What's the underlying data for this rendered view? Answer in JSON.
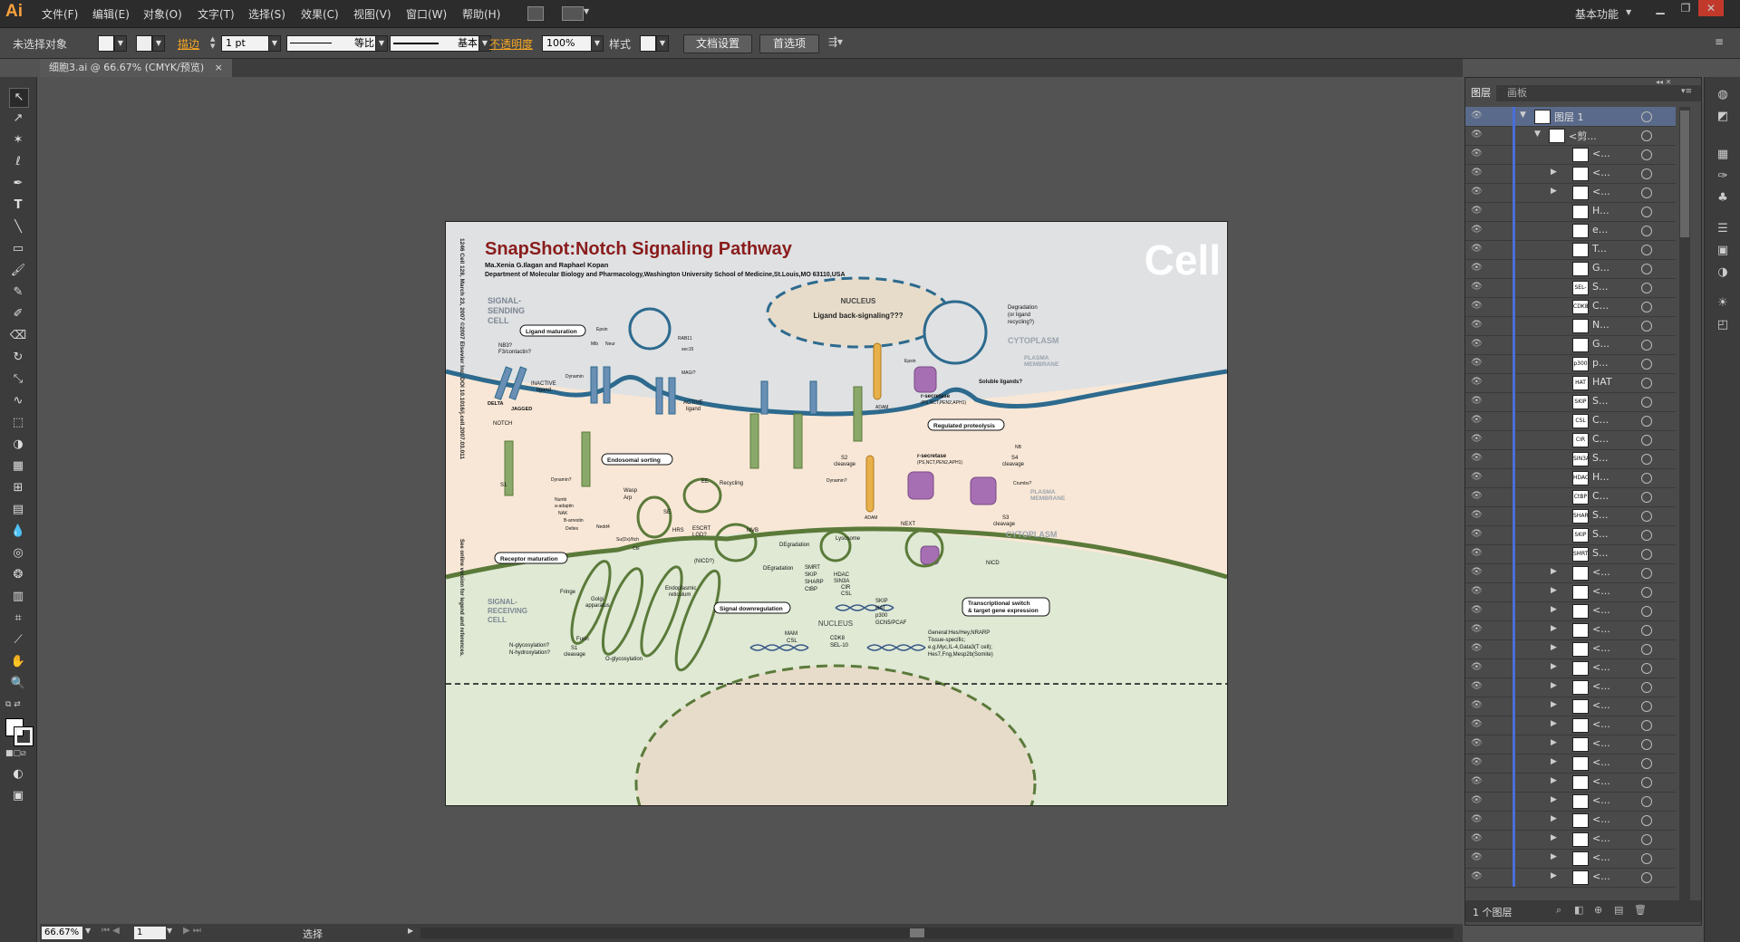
{
  "app": {
    "logo": "Ai"
  },
  "menu": [
    "文件(F)",
    "编辑(E)",
    "对象(O)",
    "文字(T)",
    "选择(S)",
    "效果(C)",
    "视图(V)",
    "窗口(W)",
    "帮助(H)"
  ],
  "workspace": "基本功能",
  "control": {
    "selection": "未选择对象",
    "stroke_label": "描边",
    "stroke_value": "1 pt",
    "stroke_profile": "等比",
    "brush": "基本",
    "opacity_label": "不透明度",
    "opacity_value": "100%",
    "style_label": "样式",
    "doc_setup": "文档设置",
    "prefs": "首选项"
  },
  "document_tab": {
    "title": "细胞3.ai @ 66.67% (CMYK/预览)",
    "close": "×"
  },
  "layers_panel": {
    "tabs": [
      "图层",
      "画板"
    ],
    "rows": [
      {
        "name": "图层 1",
        "thumb": "",
        "expanded": true,
        "indent": 0
      },
      {
        "name": "<剪...",
        "thumb": "",
        "expanded": true,
        "indent": 1
      },
      {
        "name": "<...",
        "thumb": "",
        "indent": 2
      },
      {
        "name": "<...",
        "thumb": "",
        "collapsed": true,
        "indent": 2
      },
      {
        "name": "<...",
        "thumb": "",
        "collapsed": true,
        "indent": 2
      },
      {
        "name": "H...",
        "thumb": "",
        "indent": 2
      },
      {
        "name": "e...",
        "thumb": "",
        "indent": 2
      },
      {
        "name": "T...",
        "thumb": "",
        "indent": 2
      },
      {
        "name": "G...",
        "thumb": "",
        "indent": 2
      },
      {
        "name": "S...",
        "thumb": "SEL-10",
        "indent": 2
      },
      {
        "name": "C...",
        "thumb": "CDK8",
        "indent": 2
      },
      {
        "name": "N...",
        "thumb": "",
        "indent": 2
      },
      {
        "name": "G...",
        "thumb": "",
        "indent": 2
      },
      {
        "name": "p...",
        "thumb": "p300",
        "indent": 2
      },
      {
        "name": "HAT",
        "thumb": "HAT",
        "indent": 2
      },
      {
        "name": "S...",
        "thumb": "SKIP",
        "indent": 2
      },
      {
        "name": "C...",
        "thumb": "CSL",
        "indent": 2
      },
      {
        "name": "C...",
        "thumb": "CIR",
        "indent": 2
      },
      {
        "name": "S...",
        "thumb": "SIN3A",
        "indent": 2
      },
      {
        "name": "H...",
        "thumb": "HDAC",
        "indent": 2
      },
      {
        "name": "C...",
        "thumb": "CtBP",
        "indent": 2
      },
      {
        "name": "S...",
        "thumb": "SHARP",
        "indent": 2
      },
      {
        "name": "S...",
        "thumb": "SKIP",
        "indent": 2
      },
      {
        "name": "S...",
        "thumb": "SMRT",
        "indent": 2
      },
      {
        "name": "<...",
        "thumb": "",
        "collapsed": true,
        "indent": 2
      },
      {
        "name": "<...",
        "thumb": "",
        "collapsed": true,
        "indent": 2
      },
      {
        "name": "<...",
        "thumb": "",
        "collapsed": true,
        "indent": 2
      },
      {
        "name": "<...",
        "thumb": "",
        "collapsed": true,
        "indent": 2
      },
      {
        "name": "<...",
        "thumb": "",
        "collapsed": true,
        "indent": 2
      },
      {
        "name": "<...",
        "thumb": "",
        "collapsed": true,
        "indent": 2
      },
      {
        "name": "<...",
        "thumb": "",
        "collapsed": true,
        "indent": 2
      },
      {
        "name": "<...",
        "thumb": "",
        "collapsed": true,
        "indent": 2
      },
      {
        "name": "<...",
        "thumb": "",
        "collapsed": true,
        "indent": 2
      },
      {
        "name": "<...",
        "thumb": "",
        "collapsed": true,
        "indent": 2
      },
      {
        "name": "<...",
        "thumb": "",
        "collapsed": true,
        "indent": 2
      },
      {
        "name": "<...",
        "thumb": "",
        "collapsed": true,
        "indent": 2
      },
      {
        "name": "<...",
        "thumb": "",
        "collapsed": true,
        "indent": 2
      },
      {
        "name": "<...",
        "thumb": "",
        "collapsed": true,
        "indent": 2
      },
      {
        "name": "<...",
        "thumb": "",
        "collapsed": true,
        "indent": 2
      },
      {
        "name": "<...",
        "thumb": "",
        "collapsed": true,
        "indent": 2
      },
      {
        "name": "<...",
        "thumb": "",
        "collapsed": true,
        "indent": 2
      }
    ],
    "footer_count": "1 个图层"
  },
  "status": {
    "zoom": "66.67%",
    "page": "1",
    "tool": "选择"
  },
  "artwork": {
    "title": "SnapShot:Notch Signaling Pathway",
    "authors": "Ma.Xenia G.Ilagan and Raphael Kopan",
    "affiliation": "Department of Molecular Biology and Pharmacology,Washington University School of Medicine,St.Louis,MO 63110,USA",
    "journal": "Cell",
    "citation": "1246   Cell 128, March 23, 2007 ©2007 Elsevier Inc.   DOI 10.1016/j.cell.2007.03.011",
    "see_online": "See online version for legend and references.",
    "labels": {
      "sending_cell": [
        "SIGNAL-",
        "SENDING",
        "CELL"
      ],
      "receiving_cell": [
        "SIGNAL-",
        "RECEIVING",
        "CELL"
      ],
      "nucleus_top": "NUCLEUS",
      "ligand_back": "Ligand back-signaling???",
      "cytoplasm_top": "CYTOPLASM",
      "plasma_membrane_top": [
        "PLASMA",
        "MEMBRANE"
      ],
      "cytoplasm_bottom": "CYTOPLASM",
      "plasma_membrane_bottom": [
        "PLASMA",
        "MEMBRANE"
      ],
      "nucleus_bottom": "NUCLEUS",
      "step1": "Receptor maturation",
      "step2": "Endosomal sorting",
      "step3": "Ligand maturation",
      "step4": "Regulated proteolysis",
      "step5": [
        "Transcriptional switch",
        "& target gene expression"
      ],
      "step6": "Signal downregulation",
      "degradation": [
        "Degradation",
        "(or ligand",
        "recycling?)"
      ],
      "soluble": "Soluble ligands?",
      "gamma1": "r-secretase",
      "gamma1_sub": "(PS,NCT,PEN2,APH1)",
      "gamma2": "r-secretase",
      "gamma2_sub": "(PS,NCT,PEN2,APH1)",
      "inactive": [
        "INACTIVE",
        "ligand"
      ],
      "active": [
        "ACTIVE",
        "ligand"
      ],
      "delta": "DELTA",
      "jagged": "JAGGED",
      "nb3": [
        "NB3?",
        "F3/contactin?"
      ],
      "notch": "NOTCH",
      "s1": "S1",
      "recycling": "Recycling",
      "degradation2": "DEgradation",
      "degradation3": "DEgradation",
      "lysosome": "Lysosome",
      "next": "NEXT",
      "nicd": "NICD",
      "nicd_q": "(NICD?)",
      "s2": [
        "S2",
        "cleavage"
      ],
      "s3": [
        "S3",
        "cleavage"
      ],
      "s4": [
        "S4",
        "cleavage"
      ],
      "adam_top": "ADAM",
      "adam_bottom": "ADAM",
      "mvb": "MVB",
      "hrs": "HRS",
      "escrt": [
        "ESCRT",
        "LGD?"
      ],
      "fringe": "Fringe",
      "golgi": [
        "Golgi",
        "apparatus"
      ],
      "er": [
        "Endoplasmic",
        "reticulum"
      ],
      "oglyco": "O-glycosylation",
      "nglyco": [
        "N-glycosylation?",
        "N-hydroxylation?"
      ],
      "furin": "Furin",
      "s1cleavage": [
        "S1",
        "cleavage"
      ],
      "corepressors": [
        "SMRT",
        "SKIP",
        "SHARP",
        "CtBP"
      ],
      "corepressors2": [
        "HDAC",
        "SIN3A",
        "CIR",
        "CSL"
      ],
      "coactivators": [
        "SKIP",
        "HAT",
        "p300",
        "GCN5/PCAF"
      ],
      "cdk8": [
        "CDK8",
        "SEL-10"
      ],
      "mam": [
        "MAM",
        "CSL"
      ],
      "targets": [
        "General:Hes/Hey,NRARP",
        "Tissue-specific;",
        "e.g.Myc,IL-4,Gata3(T cell);",
        "Hes7,Fng,Mesp2b(Somite)"
      ],
      "numb": [
        "Numb",
        "a-adaptin",
        "NAK",
        "B-arrestin",
        "Deltex"
      ],
      "wasp": [
        "Wasp",
        "Arp"
      ],
      "epsin": "Epsin",
      "epsin2": "Epsin",
      "dynamin": "Dynamin",
      "dynamin2": "Dynamin?",
      "dynamin3": "Dynamin?",
      "rab11": "RAB11",
      "sec15": "sec15",
      "magi": "MAGI?",
      "mib": "Mib",
      "neur": "Neur",
      "crumbs": "Crumbs?",
      "nb": "NB",
      "ee": "EE",
      "se": "SE",
      "nedd4": "Nedd4",
      "su": [
        "Su(Dx)/Itch",
        "Cbl"
      ],
      "ub": "Ub"
    }
  }
}
